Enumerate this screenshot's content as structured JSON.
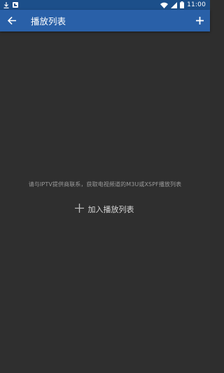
{
  "status_bar": {
    "time": "11:00",
    "left_icons": [
      "download-icon",
      "notification-app-icon"
    ],
    "right_icons": [
      "wifi-icon",
      "signal-icon",
      "battery-icon"
    ]
  },
  "app_bar": {
    "title": "播放列表",
    "back_icon": "arrow-left-icon",
    "add_icon": "plus-icon",
    "color": "#2960a8"
  },
  "empty_state": {
    "message": "请与IPTV提供商联系，获取电视频道的M3U或XSPF播放列表",
    "add_button_label": "加入播放列表",
    "add_button_icon": "plus-icon"
  },
  "colors": {
    "status_bar": "#1c4f8a",
    "background": "#2f2f2f"
  }
}
